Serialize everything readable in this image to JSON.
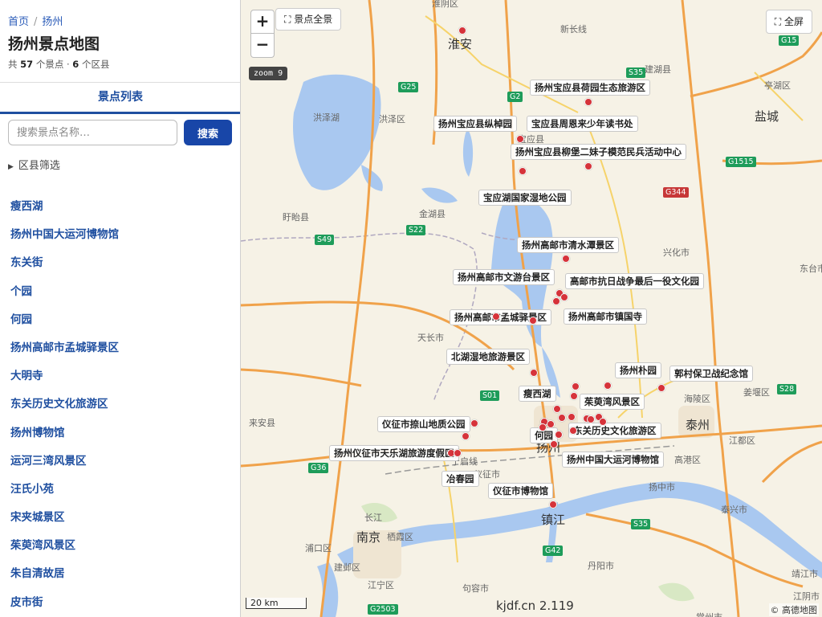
{
  "breadcrumb": {
    "home": "首页",
    "separator": "/",
    "current": "扬州"
  },
  "page_title": "扬州景点地图",
  "stats": {
    "prefix": "共",
    "spot_count": "57",
    "spot_unit": "个景点 ·",
    "district_count": "6",
    "district_unit": "个区县"
  },
  "tabs": {
    "spot_list": "景点列表"
  },
  "search": {
    "placeholder": "搜索景点名称…",
    "button": "搜索"
  },
  "filter": {
    "label": "区县筛选"
  },
  "spots": [
    "瘦西湖",
    "扬州中国大运河博物馆",
    "东关街",
    "个园",
    "何园",
    "扬州高邮市孟城驿景区",
    "大明寺",
    "东关历史文化旅游区",
    "扬州博物馆",
    "运河三湾风景区",
    "汪氏小苑",
    "宋夹城景区",
    "茱萸湾风景区",
    "朱自清故居",
    "皮市街"
  ],
  "map": {
    "controls": {
      "zoom_in": "+",
      "zoom_out": "−",
      "overview": "⛶ 景点全景",
      "fullscreen": "⛶ 全屏",
      "zoom_level": "zoom 9"
    },
    "scale": "20 km",
    "watermark": "kjdf.cn 2.119",
    "attribution": "© 高德地图",
    "cities": [
      "淮安",
      "盐城",
      "泰州",
      "扬州",
      "镇江",
      "南京"
    ],
    "places": [
      "淮阴区",
      "建湖县",
      "亭湖区",
      "洪泽湖",
      "洪泽区",
      "宝应县",
      "盱眙县",
      "金湖县",
      "兴化市",
      "东台市",
      "天长市",
      "海陵区",
      "姜堰区",
      "来安县",
      "仪征市",
      "江都区",
      "高港区",
      "扬中市",
      "泰兴市",
      "长江",
      "栖霞区",
      "浦口区",
      "建邺区",
      "江宁区",
      "句容市",
      "丹阳市",
      "靖江市",
      "江阴市",
      "常州市",
      "宁启线",
      "新长线"
    ],
    "shields": [
      "G15",
      "G25",
      "G2",
      "S35",
      "G1515",
      "G344",
      "S49",
      "S22",
      "S01",
      "S28",
      "G36",
      "G42",
      "G2503",
      "S35"
    ],
    "spot_labels": [
      "扬州宝应县荷园生态旅游区",
      "扬州宝应县纵棹园",
      "宝应县周恩来少年读书处",
      "扬州宝应县柳堡二妹子模范民兵活动中心",
      "宝应湖国家湿地公园",
      "扬州高邮市清水潭景区",
      "扬州高邮市文游台景区",
      "高邮市抗日战争最后一役文化园",
      "扬州高邮市孟城驿景区",
      "扬州高邮市镇国寺",
      "北湖湿地旅游景区",
      "扬州朴园",
      "郭村保卫战纪念馆",
      "瘦西湖",
      "茱萸湾风景区",
      "仪征市捺山地质公园",
      "何园",
      "东关历史文化旅游区",
      "扬州仪征市天乐湖旅游度假区",
      "扬州中国大运河博物馆",
      "冶春园",
      "仪征市博物馆"
    ],
    "marker_count": 34,
    "colors": {
      "marker": "#d6333a",
      "water": "#a9c8f0",
      "highway": "#f0a24a",
      "accent": "#1846a8"
    }
  }
}
